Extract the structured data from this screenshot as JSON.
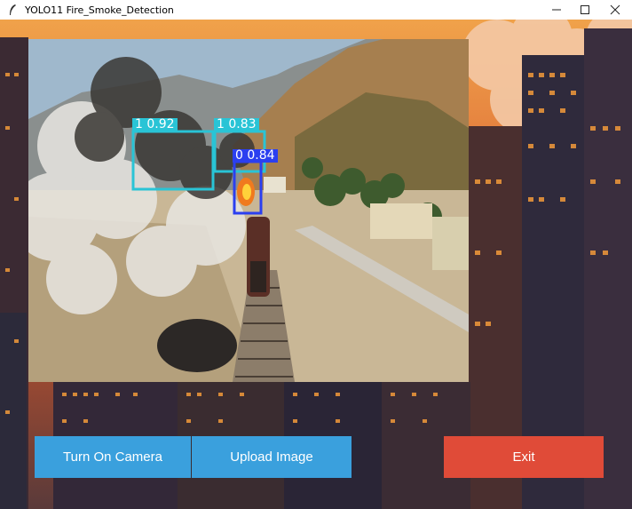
{
  "window": {
    "title": "YOLO11 Fire_Smoke_Detection",
    "controls": {
      "minimize": "—",
      "maximize": "☐",
      "close": "✕"
    }
  },
  "detections": [
    {
      "label": "1  0.92",
      "class": "smoke",
      "color": "#29c4d6"
    },
    {
      "label": "1  0.83",
      "class": "smoke",
      "color": "#29c4d6"
    },
    {
      "label": "0  0.84",
      "class": "fire",
      "color": "#2b3ff0"
    }
  ],
  "buttons": {
    "camera": "Turn On Camera",
    "upload": "Upload Image",
    "exit": "Exit"
  },
  "colors": {
    "primary_button": "#3aa0dd",
    "exit_button": "#e04b38"
  }
}
